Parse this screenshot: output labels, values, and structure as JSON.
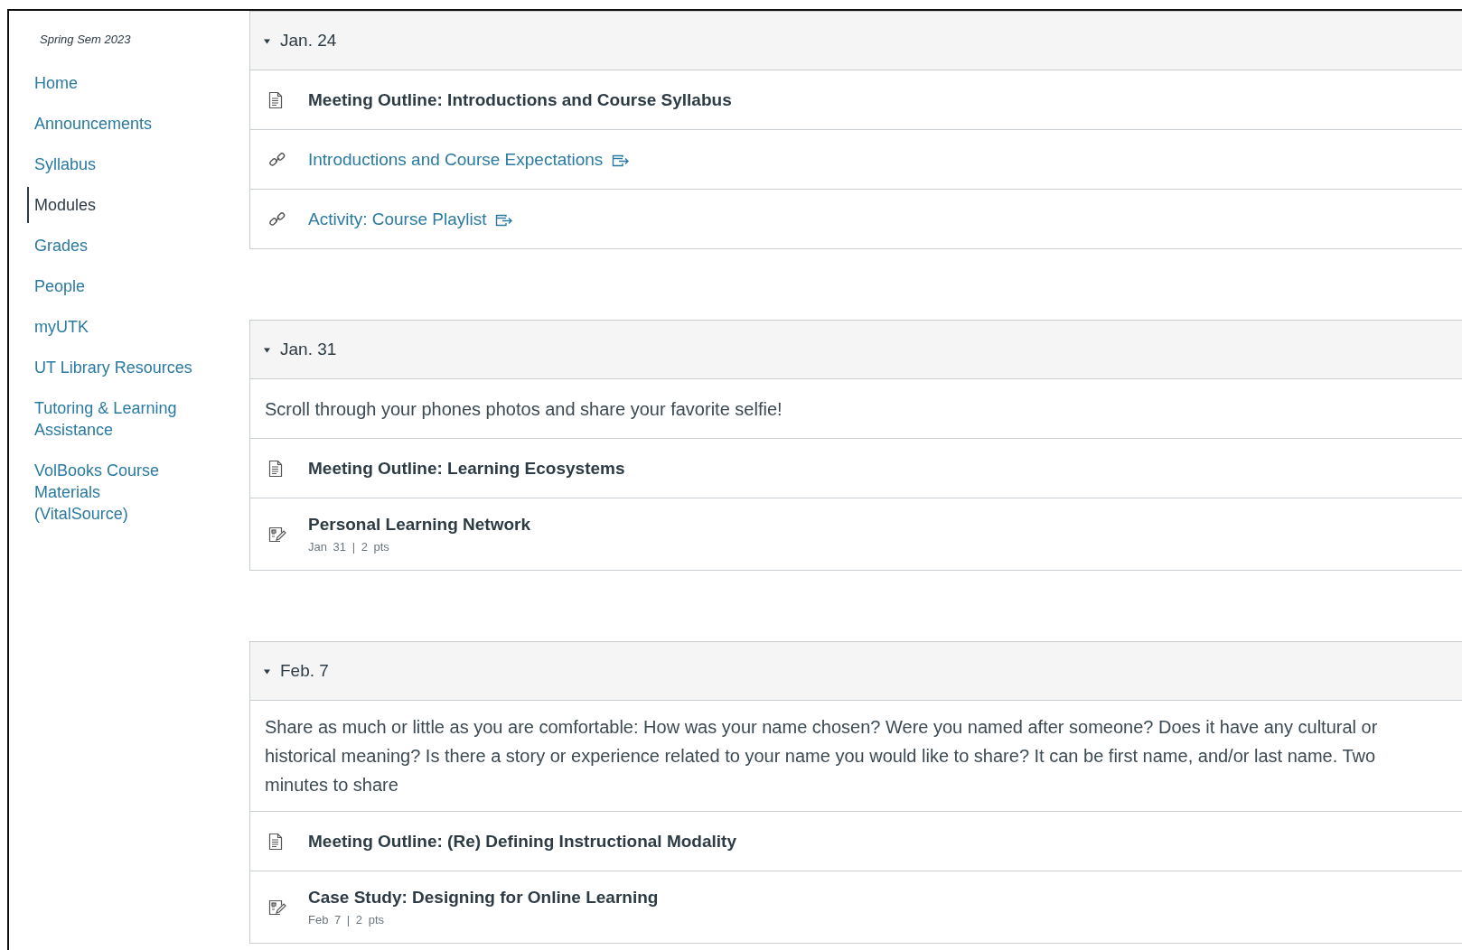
{
  "sidebar": {
    "term": "Spring Sem 2023",
    "items": [
      {
        "label": "Home",
        "selected": false
      },
      {
        "label": "Announcements",
        "selected": false
      },
      {
        "label": "Syllabus",
        "selected": false
      },
      {
        "label": "Modules",
        "selected": true
      },
      {
        "label": "Grades",
        "selected": false
      },
      {
        "label": "People",
        "selected": false
      },
      {
        "label": "myUTK",
        "selected": false
      },
      {
        "label": "UT Library Resources",
        "selected": false
      },
      {
        "label": "Tutoring & Learning Assistance",
        "selected": false
      },
      {
        "label": "VolBooks Course Materials (VitalSource)",
        "selected": false
      }
    ]
  },
  "modules": [
    {
      "title": "Jan. 24",
      "expanded": true,
      "items": [
        {
          "kind": "page",
          "title": "Meeting Outline: Introductions and Course Syllabus"
        },
        {
          "kind": "link",
          "title": "Introductions and Course Expectations",
          "external": true
        },
        {
          "kind": "link",
          "title": "Activity: Course Playlist",
          "external": true
        }
      ]
    },
    {
      "title": "Jan. 31",
      "expanded": true,
      "items": [
        {
          "kind": "text",
          "title": "Scroll through your phones photos and share your favorite selfie!"
        },
        {
          "kind": "page",
          "title": "Meeting Outline: Learning Ecosystems"
        },
        {
          "kind": "assignment",
          "title": "Personal Learning Network",
          "details": "Jan 31 | 2 pts"
        }
      ]
    },
    {
      "title": "Feb. 7",
      "expanded": true,
      "items": [
        {
          "kind": "text",
          "title": "Share as much or little as you are comfortable: How was your name chosen? Were you named after someone? Does it have any cultural or historical meaning? Is there a story or experience related to your name you would like to share? It can be first name, and/or last name. Two minutes to share"
        },
        {
          "kind": "page",
          "title": "Meeting Outline: (Re) Defining Instructional Modality"
        },
        {
          "kind": "assignment",
          "title": "Case Study: Designing for Online Learning",
          "details": "Feb 7 | 2 pts"
        }
      ]
    }
  ]
}
